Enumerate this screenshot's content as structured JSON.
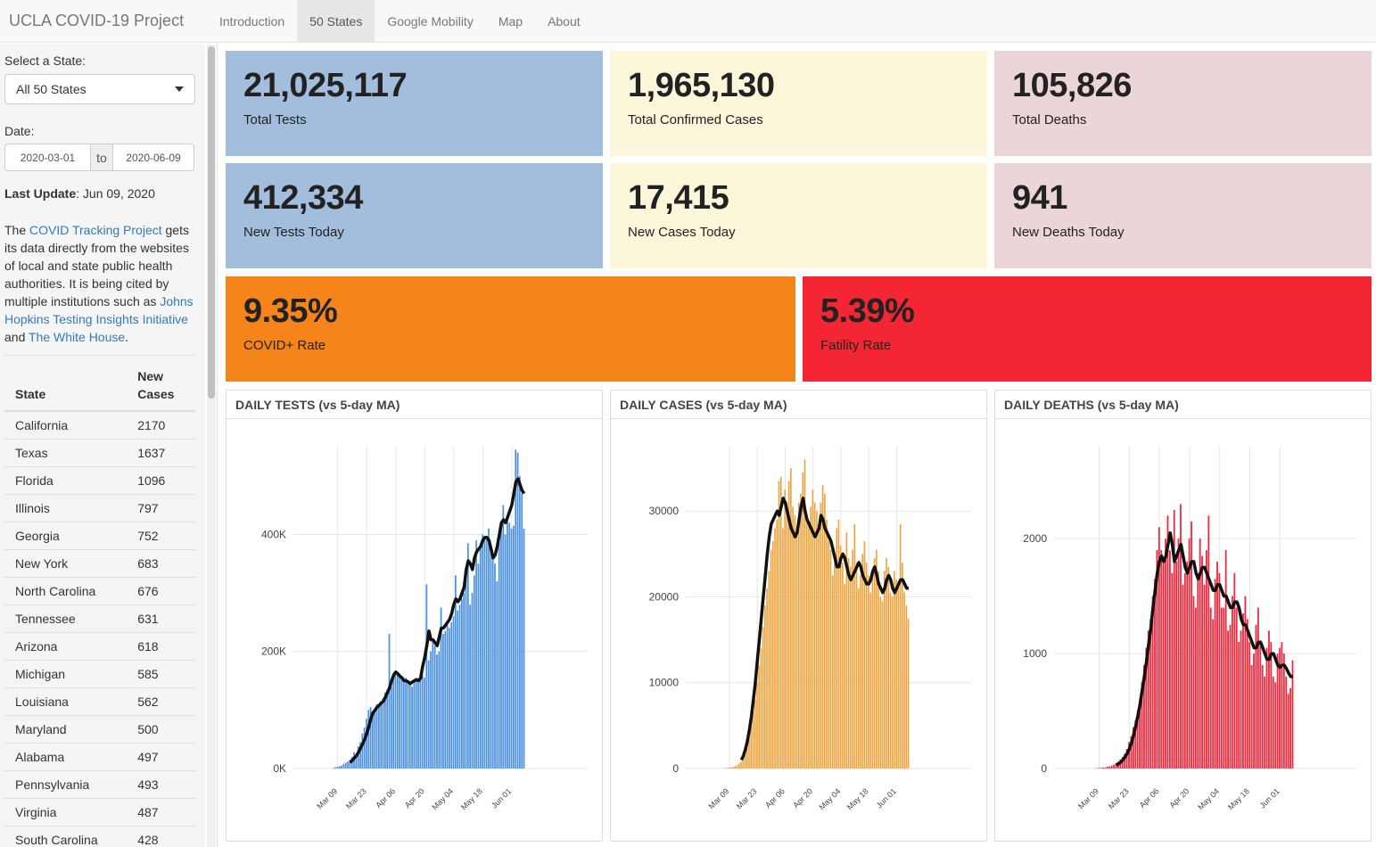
{
  "nav": {
    "brand": "UCLA COVID-19 Project",
    "tabs": [
      {
        "label": "Introduction"
      },
      {
        "label": "50 States"
      },
      {
        "label": "Google Mobility"
      },
      {
        "label": "Map"
      },
      {
        "label": "About"
      }
    ],
    "active_tab": "50 States"
  },
  "sidebar": {
    "state_label": "Select a State:",
    "state_value": "All 50 States",
    "date_label": "Date:",
    "date_from": "2020-03-01",
    "date_sep": "to",
    "date_to": "2020-06-09",
    "last_update_label": "Last Update",
    "last_update_value": ": Jun 09, 2020",
    "desc": {
      "t1": "The ",
      "link1": "COVID Tracking Project",
      "t2": " gets its data directly from the websites of local and state public health authorities. It is being cited by multiple institutions such as ",
      "link2": "Johns Hopkins Testing Insights Initiative",
      "t3": " and ",
      "link3": "The White House",
      "t4": "."
    },
    "table": {
      "col_state": "State",
      "col_cases_1": "New",
      "col_cases_2": "Cases",
      "rows": [
        {
          "state": "California",
          "cases": "2170"
        },
        {
          "state": "Texas",
          "cases": "1637"
        },
        {
          "state": "Florida",
          "cases": "1096"
        },
        {
          "state": "Illinois",
          "cases": "797"
        },
        {
          "state": "Georgia",
          "cases": "752"
        },
        {
          "state": "New York",
          "cases": "683"
        },
        {
          "state": "North Carolina",
          "cases": "676"
        },
        {
          "state": "Tennessee",
          "cases": "631"
        },
        {
          "state": "Arizona",
          "cases": "618"
        },
        {
          "state": "Michigan",
          "cases": "585"
        },
        {
          "state": "Louisiana",
          "cases": "562"
        },
        {
          "state": "Maryland",
          "cases": "500"
        },
        {
          "state": "Alabama",
          "cases": "497"
        },
        {
          "state": "Pennsylvania",
          "cases": "493"
        },
        {
          "state": "Virginia",
          "cases": "487"
        },
        {
          "state": "South Carolina",
          "cases": "428"
        }
      ]
    }
  },
  "boxes": {
    "total_tests": {
      "value": "21,025,117",
      "label": "Total Tests"
    },
    "total_cases": {
      "value": "1,965,130",
      "label": "Total Confirmed Cases"
    },
    "total_deaths": {
      "value": "105,826",
      "label": "Total Deaths"
    },
    "new_tests": {
      "value": "412,334",
      "label": "New Tests Today"
    },
    "new_cases": {
      "value": "17,415",
      "label": "New Cases Today"
    },
    "new_deaths": {
      "value": "941",
      "label": "New Deaths Today"
    },
    "covid_rate": {
      "value": "9.35%",
      "label": "COVID+ Rate"
    },
    "fatality_rate": {
      "value": "5.39%",
      "label": "Fatility Rate"
    }
  },
  "colors": {
    "tests_bar": "#4a90e2",
    "cases_bar": "#f0a33c",
    "deaths_bar": "#eb2b3f",
    "ma_line": "#111111",
    "blue_box": "#a3bedd",
    "yellow_box": "#fcf7db",
    "pink_box": "#ecd5d6",
    "orange_box": "#f5841a",
    "red_box": "#f52633"
  },
  "chart_data": [
    {
      "type": "bar",
      "title": "DAILY TESTS (vs 5-day MA)",
      "x_start": "2020-03-01",
      "x_ticks": [
        "Mar 09",
        "Mar 23",
        "Apr 06",
        "Apr 20",
        "May 04",
        "May 18",
        "Jun 01"
      ],
      "y_ticks": [
        "0K",
        "200K",
        "400K"
      ],
      "y_tick_values": [
        0,
        200000,
        400000
      ],
      "ylim": [
        0,
        550000
      ],
      "grid": true,
      "series": [
        {
          "name": "bars",
          "values": [
            0,
            0,
            0,
            0,
            0,
            0,
            1000,
            2000,
            3000,
            4000,
            5000,
            8000,
            10000,
            12000,
            15000,
            20000,
            28000,
            25000,
            38000,
            45000,
            60000,
            70000,
            85000,
            100000,
            105000,
            95000,
            100000,
            110000,
            105000,
            115000,
            120000,
            130000,
            135000,
            230000,
            140000,
            155000,
            160000,
            165000,
            160000,
            158000,
            150000,
            155000,
            148000,
            145000,
            140000,
            150000,
            152000,
            148000,
            155000,
            160000,
            155000,
            315000,
            185000,
            200000,
            220000,
            210000,
            195000,
            200000,
            275000,
            230000,
            235000,
            245000,
            240000,
            250000,
            260000,
            330000,
            270000,
            280000,
            290000,
            300000,
            340000,
            385000,
            280000,
            300000,
            330000,
            390000,
            350000,
            385000,
            400000,
            395000,
            395000,
            410000,
            380000,
            360000,
            350000,
            320000,
            400000,
            420000,
            450000,
            400000,
            425000,
            420000,
            410000,
            415000,
            545000,
            540000,
            500000,
            470000,
            410000
          ]
        },
        {
          "name": "5-day MA",
          "values": [
            null,
            null,
            null,
            null,
            null,
            null,
            null,
            null,
            null,
            null,
            null,
            null,
            null,
            null,
            10000,
            14000,
            18000,
            22000,
            28000,
            35000,
            42000,
            50000,
            60000,
            72000,
            85000,
            95000,
            100000,
            105000,
            108000,
            112000,
            115000,
            122000,
            130000,
            138000,
            150000,
            160000,
            165000,
            162000,
            158000,
            155000,
            150000,
            150000,
            148000,
            145000,
            148000,
            150000,
            152000,
            150000,
            155000,
            175000,
            190000,
            210000,
            235000,
            220000,
            220000,
            215000,
            210000,
            225000,
            240000,
            240000,
            245000,
            250000,
            255000,
            265000,
            280000,
            290000,
            285000,
            290000,
            300000,
            310000,
            340000,
            355000,
            350000,
            340000,
            360000,
            370000,
            375000,
            380000,
            390000,
            395000,
            395000,
            390000,
            375000,
            360000,
            365000,
            380000,
            400000,
            420000,
            425000,
            420000,
            430000,
            440000,
            450000,
            470000,
            490000,
            495000,
            485000,
            475000,
            470000
          ]
        }
      ]
    },
    {
      "type": "bar",
      "title": "DAILY CASES (vs 5-day MA)",
      "x_start": "2020-03-01",
      "x_ticks": [
        "Mar 09",
        "Mar 23",
        "Apr 06",
        "Apr 20",
        "May 04",
        "May 18",
        "Jun 01"
      ],
      "y_ticks": [
        "0",
        "10000",
        "20000",
        "30000"
      ],
      "y_tick_values": [
        0,
        10000,
        20000,
        30000
      ],
      "ylim": [
        0,
        37500
      ],
      "grid": true,
      "series": [
        {
          "name": "bars",
          "values": [
            0,
            0,
            0,
            0,
            0,
            0,
            50,
            80,
            100,
            150,
            200,
            300,
            400,
            600,
            800,
            1200,
            1800,
            2500,
            3500,
            5000,
            6500,
            8000,
            10000,
            12000,
            14000,
            16500,
            19000,
            21000,
            23000,
            25500,
            26500,
            28000,
            29000,
            33500,
            34000,
            28000,
            32500,
            31000,
            33500,
            35000,
            30500,
            29500,
            27500,
            31000,
            32000,
            34500,
            36000,
            29000,
            28500,
            30500,
            32500,
            31000,
            30000,
            28500,
            31000,
            33000,
            32000,
            29000,
            26500,
            25500,
            22500,
            24000,
            28000,
            29000,
            26000,
            24000,
            21500,
            27500,
            24500,
            23500,
            25500,
            28500,
            24000,
            21000,
            22500,
            25000,
            26500,
            24000,
            22500,
            20500,
            23000,
            24500,
            25500,
            23000,
            20000,
            19500,
            23000,
            24500,
            23500,
            20500,
            20000,
            23000,
            22000,
            21500,
            28500,
            24000,
            20500,
            19000,
            17500
          ]
        },
        {
          "name": "5-day MA",
          "values": [
            null,
            null,
            null,
            null,
            null,
            null,
            null,
            null,
            null,
            null,
            null,
            null,
            null,
            null,
            1000,
            1500,
            2200,
            3200,
            4500,
            6000,
            8000,
            10000,
            12500,
            15000,
            17500,
            20000,
            22500,
            25000,
            27000,
            28500,
            29000,
            29500,
            30000,
            29500,
            30500,
            31500,
            31000,
            30000,
            29000,
            28000,
            27500,
            27000,
            27500,
            29000,
            30500,
            31500,
            30000,
            29000,
            28500,
            28000,
            27500,
            27000,
            27500,
            28000,
            29500,
            29000,
            28000,
            27500,
            27000,
            26500,
            25500,
            24500,
            23500,
            23500,
            24500,
            25000,
            24500,
            23500,
            22500,
            22000,
            22500,
            23000,
            23500,
            24000,
            23500,
            22500,
            22000,
            21500,
            21500,
            22000,
            23000,
            23500,
            22500,
            21500,
            21000,
            20500,
            21000,
            22000,
            22500,
            22000,
            21000,
            20500,
            21000,
            21500,
            22000,
            22000,
            21500,
            21000,
            21000
          ]
        }
      ]
    },
    {
      "type": "bar",
      "title": "DAILY DEATHS (vs 5-day MA)",
      "x_start": "2020-03-01",
      "x_ticks": [
        "Mar 09",
        "Mar 23",
        "Apr 06",
        "Apr 20",
        "May 04",
        "May 18",
        "Jun 01"
      ],
      "y_ticks": [
        "0",
        "1000",
        "2000"
      ],
      "y_tick_values": [
        0,
        1000,
        2000
      ],
      "ylim": [
        0,
        2800
      ],
      "grid": true,
      "series": [
        {
          "name": "bars",
          "values": [
            0,
            0,
            0,
            0,
            0,
            0,
            2,
            3,
            5,
            6,
            8,
            10,
            15,
            20,
            25,
            35,
            50,
            60,
            80,
            100,
            130,
            170,
            230,
            280,
            360,
            420,
            500,
            600,
            750,
            900,
            1050,
            1200,
            1300,
            1500,
            1650,
            1900,
            2100,
            1900,
            1800,
            2000,
            2200,
            1900,
            1700,
            2250,
            1800,
            2000,
            2300,
            1600,
            1700,
            1800,
            2000,
            2150,
            1500,
            1400,
            1700,
            2000,
            1850,
            1600,
            1900,
            2200,
            1400,
            1300,
            1650,
            1800,
            1700,
            1400,
            1400,
            1900,
            1200,
            1250,
            1500,
            1700,
            1400,
            1100,
            1200,
            1350,
            1500,
            1300,
            1100,
            900,
            1000,
            1250,
            1400,
            1100,
            900,
            800,
            1050,
            1200,
            1100,
            800,
            750,
            1000,
            1050,
            1100,
            1000,
            800,
            650,
            700,
            941
          ]
        },
        {
          "name": "5-day MA",
          "values": [
            null,
            null,
            null,
            null,
            null,
            null,
            null,
            null,
            null,
            null,
            null,
            null,
            null,
            null,
            null,
            null,
            30,
            40,
            55,
            75,
            100,
            130,
            170,
            220,
            290,
            370,
            460,
            560,
            680,
            800,
            930,
            1080,
            1220,
            1400,
            1550,
            1700,
            1800,
            1850,
            1800,
            1850,
            1950,
            2050,
            1950,
            1800,
            1850,
            1900,
            1950,
            1850,
            1750,
            1700,
            1750,
            1800,
            1800,
            1700,
            1650,
            1700,
            1750,
            1750,
            1700,
            1650,
            1600,
            1550,
            1550,
            1600,
            1600,
            1550,
            1500,
            1500,
            1450,
            1400,
            1400,
            1450,
            1450,
            1400,
            1300,
            1250,
            1250,
            1200,
            1150,
            1100,
            1050,
            1050,
            1100,
            1100,
            1050,
            1000,
            950,
            950,
            1000,
            1000,
            950,
            900,
            880,
            900,
            900,
            870,
            830,
            800,
            800
          ]
        }
      ]
    }
  ]
}
